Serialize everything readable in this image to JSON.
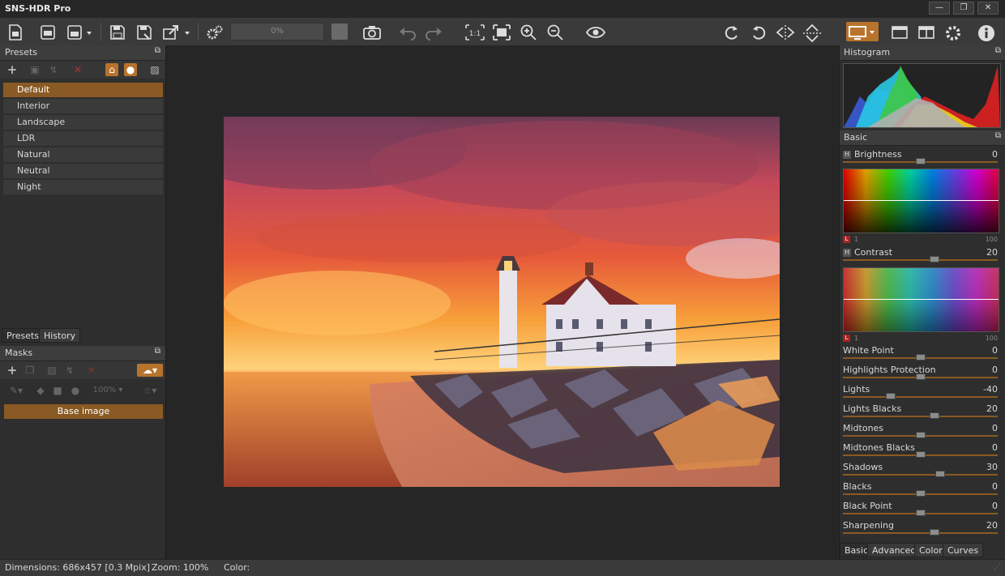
{
  "app": {
    "title": "SNS-HDR Pro"
  },
  "window": {
    "minimize": "—",
    "maximize": "❐",
    "close": "✕"
  },
  "toolbar": {
    "progress": "0%"
  },
  "presets_panel": {
    "title": "Presets",
    "items": [
      "Default",
      "Interior",
      "Landscape",
      "LDR",
      "Natural",
      "Neutral",
      "Night"
    ],
    "selected": "Default",
    "tabs": [
      "Presets",
      "History"
    ]
  },
  "masks_panel": {
    "title": "Masks",
    "zoom": "100%",
    "base_image": "Base image"
  },
  "histogram_panel": {
    "title": "Histogram"
  },
  "basic_panel": {
    "title": "Basic",
    "brightness": {
      "label": "Brightness",
      "value": "0",
      "level": 0.5
    },
    "contrast": {
      "label": "Contrast",
      "value": "20",
      "level": 0.59
    },
    "scale_min": "1",
    "scale_max": "100",
    "sliders": [
      {
        "label": "White Point",
        "value": "0",
        "level": 0.5
      },
      {
        "label": "Highlights Protection",
        "value": "0",
        "level": 0.5
      },
      {
        "label": "Lights",
        "value": "-40",
        "level": 0.31
      },
      {
        "label": "Lights Blacks",
        "value": "20",
        "level": 0.59
      },
      {
        "label": "Midtones",
        "value": "0",
        "level": 0.5
      },
      {
        "label": "Midtones Blacks",
        "value": "0",
        "level": 0.5
      },
      {
        "label": "Shadows",
        "value": "30",
        "level": 0.63
      },
      {
        "label": "Blacks",
        "value": "0",
        "level": 0.5
      },
      {
        "label": "Black Point",
        "value": "0",
        "level": 0.5
      },
      {
        "label": "Sharpening",
        "value": "20",
        "level": 0.59
      }
    ],
    "tabs": [
      "Basic",
      "Advanced",
      "Color",
      "Curves"
    ],
    "active_tab": "Basic"
  },
  "statusbar": {
    "dimensions": "Dimensions: 686x457 [0.3 Mpix]",
    "zoom": "Zoom: 100%",
    "color": "Color:"
  },
  "colors": {
    "accent": "#8a5a24",
    "accent_orange": "#b8732c"
  }
}
